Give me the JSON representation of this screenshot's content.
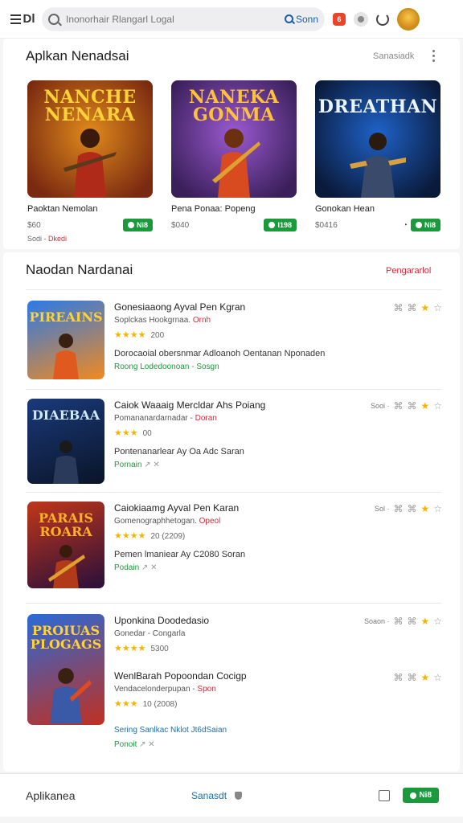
{
  "topbar": {
    "menu_glyph": "Dl",
    "search_placeholder": "Inonorhair Rlangarl Logal",
    "search_button": "Sonn",
    "badge": "6"
  },
  "featured": {
    "title": "Aplkan Nenadsai",
    "link": "Sanasiadk",
    "tiles": [
      {
        "art_title": "NANCHE NENARA",
        "name": "Paoktan Nemolan",
        "meta": "$60",
        "button": "Ni8",
        "sub_a": "Sodi - ",
        "sub_b": "Dkedi",
        "palette": [
          "#e08a1c",
          "#7a2a10"
        ],
        "title_color": "#ffd23a"
      },
      {
        "art_title": "NANEKA GONMA",
        "name": "Pena Ponaa: Popeng",
        "meta": "$040",
        "button": "I198",
        "sub_a": "",
        "sub_b": "",
        "palette": [
          "#9a5ad0",
          "#3a1f5a"
        ],
        "title_color": "#ffc03a"
      },
      {
        "art_title": "DREATHAN",
        "name": "Gonokan Hean",
        "meta": "$0416",
        "button": "Ni8",
        "sub_a": "",
        "sub_b": "",
        "palette": [
          "#1f62c8",
          "#0a1a3a"
        ],
        "title_color": "#e8f4ff"
      }
    ]
  },
  "list": {
    "title": "Naodan Nardanai",
    "link": "Pengararlol",
    "rows": [
      {
        "art_title": "PIREAINS",
        "palette": [
          "#2a7ae8",
          "#f08a20"
        ],
        "title_color": "#ffd23a",
        "title": "Gonesiaaong Ayval Pen Kgran",
        "sub": "Soplckas Hookgrnaa. ",
        "sub_red": "Ornh",
        "stars": "★★★★",
        "count": "200",
        "desc": "Dorocaoial obersnmar Adloanoh Oentanan Nponaden",
        "green_a": "Roong Lodedoonoan - ",
        "green_b": "Sosgn",
        "side_label": "",
        "side_icons": "⌘ ⌘"
      },
      {
        "art_title": "DIAEBAA",
        "palette": [
          "#1a3a7a",
          "#0a1428"
        ],
        "title_color": "#cfe8ff",
        "title": "Caiok Waaaig Mercldar Ahs Poiang",
        "sub": "Pomananardarnadar - ",
        "sub_red": "Doran",
        "stars": "★★★",
        "count": "00",
        "desc": "Pontenanarlear Ay Oa Adc Saran",
        "green_a": "Pornain ",
        "green_b": "",
        "side_label": "Sooi ·",
        "side_icons": "⌘ ⌘"
      },
      {
        "art_title": "PARAIS ROARA",
        "palette": [
          "#c0361a",
          "#2a0f3a"
        ],
        "title_color": "#ffb02a",
        "title": "Caiokiaamg Ayval Pen Karan",
        "sub": "Gomenographhetogan. ",
        "sub_red": "Opeol",
        "stars": "★★★★",
        "count": "20 (2209)",
        "desc": "Pemen lmaniear Ay C2080 Soran",
        "green_a": "Podain ",
        "green_b": "",
        "side_label": "Sol ·",
        "side_icons": "⌘ ⌘"
      },
      {
        "art_title": "PROIUAS PLOGAGS",
        "palette": [
          "#2a6ad8",
          "#c03020"
        ],
        "title_color": "#ffd23a",
        "title": "Uponkina Doodedasio",
        "sub": "Gonedar - Congarla",
        "sub_red": "",
        "stars": "★★★★",
        "count": "5300",
        "desc": "",
        "green_a": "",
        "green_b": "",
        "side_label": "Soaon ·",
        "side_icons": "⌘ ⌘",
        "title2": "WenlBarah Popoondan Cocigp",
        "sub2": "Vendacelonderpupan - ",
        "sub2_red": "Spon",
        "stars2": "★★★",
        "count2": "10 (2008)",
        "blue_line": "Sering Sanlkac Nklot Jt6dSaian",
        "green2": "Ponoit "
      }
    ]
  },
  "bottombar": {
    "left": "Aplikanea",
    "mid": "Sanasdt",
    "button": "Ni8"
  }
}
